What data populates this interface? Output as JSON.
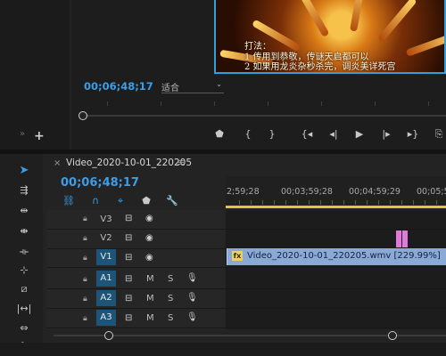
{
  "program_monitor": {
    "subtitles": [
      "打法：",
      "1 传用到恭敬，传谜天启都可以",
      "2 如果用龙炎杂秒杀完，调炎美详死宫"
    ],
    "timecode": "00;06;48;17",
    "fit_label": "适合"
  },
  "transport_controls": [
    "marker-add",
    "mark-in",
    "mark-out",
    "go-to-in",
    "step-back",
    "play",
    "step-forward",
    "go-to-out",
    "insert"
  ],
  "timeline": {
    "sequence_name": "Video_2020-10-01_220205",
    "timecode": "00;06;48;17",
    "ruler_labels": [
      "2;59;28",
      "00;03;59;28",
      "00;04;59;29",
      "00;05;5"
    ],
    "tracks": [
      {
        "name": "V3",
        "type": "video",
        "active": false
      },
      {
        "name": "V2",
        "type": "video",
        "active": false
      },
      {
        "name": "V1",
        "type": "video",
        "active": true,
        "source": "V1"
      },
      {
        "name": "A1",
        "type": "audio",
        "active": true,
        "source": "A1"
      },
      {
        "name": "A2",
        "type": "audio",
        "active": true,
        "source": "A2"
      },
      {
        "name": "A3",
        "type": "audio",
        "active": true,
        "source": "A3"
      }
    ],
    "mute_label": "M",
    "solo_label": "S",
    "clip_v1": {
      "fx_label": "fx",
      "label": "Video_2020-10-01_220205.wmv [229.99%]"
    }
  },
  "colors": {
    "accent": "#3c9ee8",
    "clip_video": "#8aa9d6",
    "clip_pink": "#e07ad8",
    "work_area": "#d8c84a"
  }
}
